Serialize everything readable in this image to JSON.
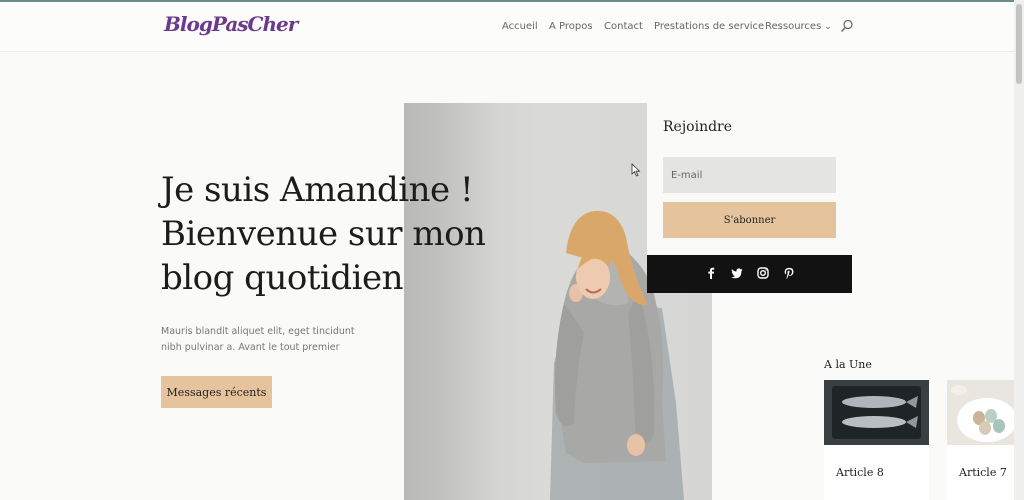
{
  "logo_text": "BlogPasCher",
  "nav": {
    "items": [
      "Accueil",
      "A Propos",
      "Contact",
      "Prestations de service",
      "Ressources"
    ],
    "search_icon": "search-icon",
    "dropdown_icon": "chevron-down-icon"
  },
  "hero": {
    "title_lines": [
      "Je suis Amandine !",
      "Bienvenue sur mon",
      "blog quotidien"
    ],
    "description": "Mauris blandit aliquet elit, eget tincidunt nibh pulvinar a. Avant le tout premier",
    "button_label": "Messages récents"
  },
  "subscribe": {
    "title": "Rejoindre",
    "email_placeholder": "E-mail",
    "button_label": "S'abonner"
  },
  "social": {
    "icons": [
      "facebook-icon",
      "twitter-icon",
      "instagram-icon",
      "pinterest-icon"
    ]
  },
  "featured": {
    "heading": "A la Une",
    "articles": [
      {
        "title": "Article 8"
      },
      {
        "title": "Article 7"
      }
    ]
  },
  "colors": {
    "accent": "#e5c49d",
    "logo": "#6b3a8e",
    "dark": "#121212",
    "background": "#fafaf8"
  }
}
